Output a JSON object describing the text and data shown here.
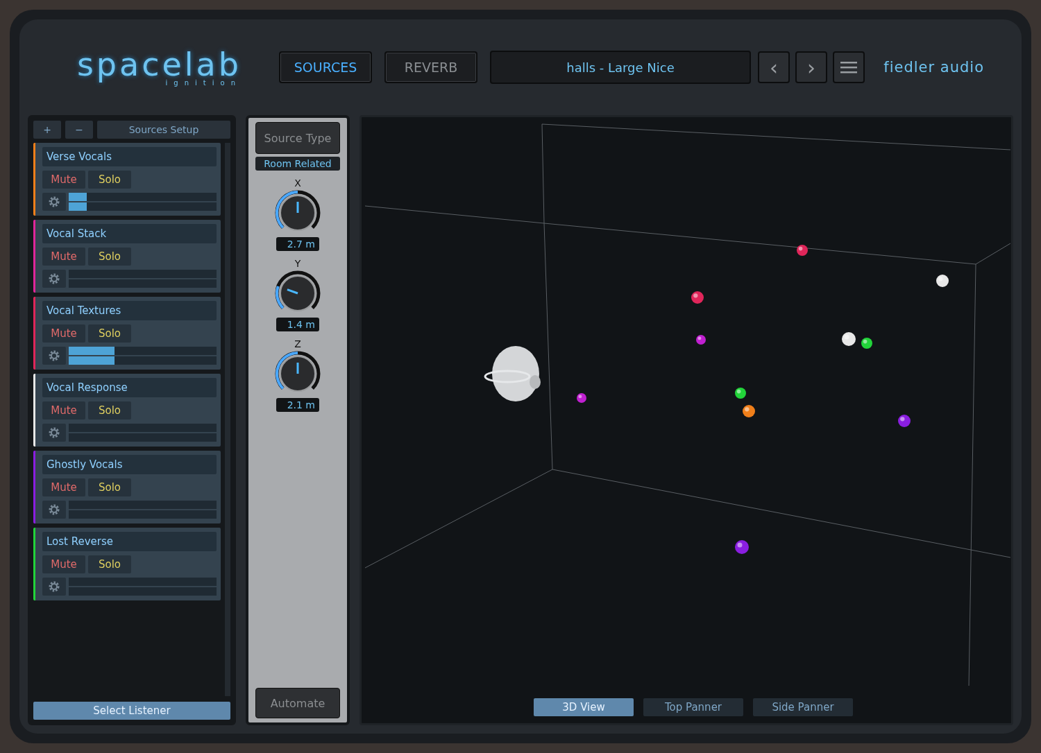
{
  "logo": {
    "name": "spacelab",
    "subtitle": "ignition"
  },
  "tabs": [
    {
      "label": "SOURCES",
      "selected": true
    },
    {
      "label": "REVERB",
      "selected": false
    }
  ],
  "preset": "halls - Large Nice",
  "nav": {
    "prev": "‹",
    "next": "›"
  },
  "brand": "fiedler audio",
  "sources_panel": {
    "add": "+",
    "remove": "−",
    "setup": "Sources Setup",
    "sources": [
      {
        "name": "Verse Vocals",
        "color": "#f07f1a",
        "mute": "Mute",
        "solo": "Solo",
        "level": 0.12
      },
      {
        "name": "Vocal Stack",
        "color": "#e0269a",
        "mute": "Mute",
        "solo": "Solo"
      },
      {
        "name": "Vocal Textures",
        "color": "#e0265a",
        "mute": "Mute",
        "solo": "Solo",
        "level": 0.31
      },
      {
        "name": "Vocal Response",
        "color": "#e8e8e8",
        "mute": "Mute",
        "solo": "Solo"
      },
      {
        "name": "Ghostly Vocals",
        "color": "#8a1ee0",
        "mute": "Mute",
        "solo": "Solo"
      },
      {
        "name": "Lost Reverse",
        "color": "#22d43a",
        "mute": "Mute",
        "solo": "Solo"
      }
    ],
    "select_listener": "Select Listener"
  },
  "source_settings": {
    "source_type": "Source Type",
    "type_value": "Room Related",
    "knobs": [
      {
        "axis": "X",
        "level": 0.5,
        "reading": "2.7 m"
      },
      {
        "axis": "Y",
        "level": 0.24,
        "reading": "1.4 m"
      },
      {
        "axis": "Z",
        "level": 0.5,
        "reading": "2.1 m"
      }
    ],
    "automate": "Automate"
  },
  "view_tabs": [
    {
      "label": "3D View",
      "selected": true
    },
    {
      "label": "Top Panner",
      "selected": false
    },
    {
      "label": "Side Panner",
      "selected": false
    }
  ]
}
